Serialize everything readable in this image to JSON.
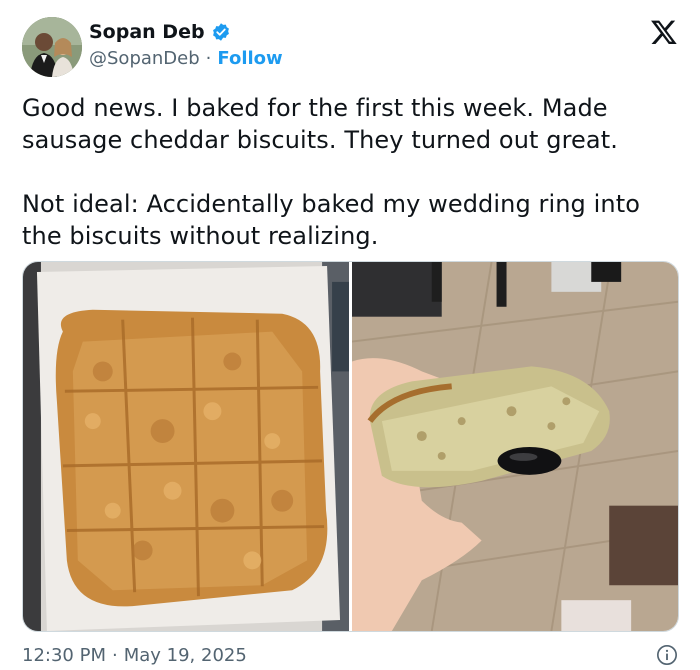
{
  "author": {
    "display_name": "Sopan Deb",
    "handle": "@SopanDeb",
    "separator": "·",
    "follow_label": "Follow",
    "verified": true,
    "avatar_icon": "user-avatar-photo"
  },
  "brand": {
    "logo_icon": "x-logo-icon"
  },
  "tweet": {
    "paragraphs": [
      "Good news. I baked for the first this week. Made sausage cheddar biscuits. They turned out great.",
      "Not ideal: Accidentally baked my wedding ring into the biscuits without realizing."
    ]
  },
  "media": {
    "photos": [
      "biscuit-tray-photo",
      "biscuit-with-ring-photo"
    ]
  },
  "footer": {
    "time": "12:30 PM",
    "separator": "·",
    "date": "May 19, 2025",
    "info_icon": "info-icon"
  },
  "colors": {
    "accent": "#1d9bf0",
    "text": "#0f1419",
    "secondary": "#536471",
    "border": "#cfd9de"
  }
}
